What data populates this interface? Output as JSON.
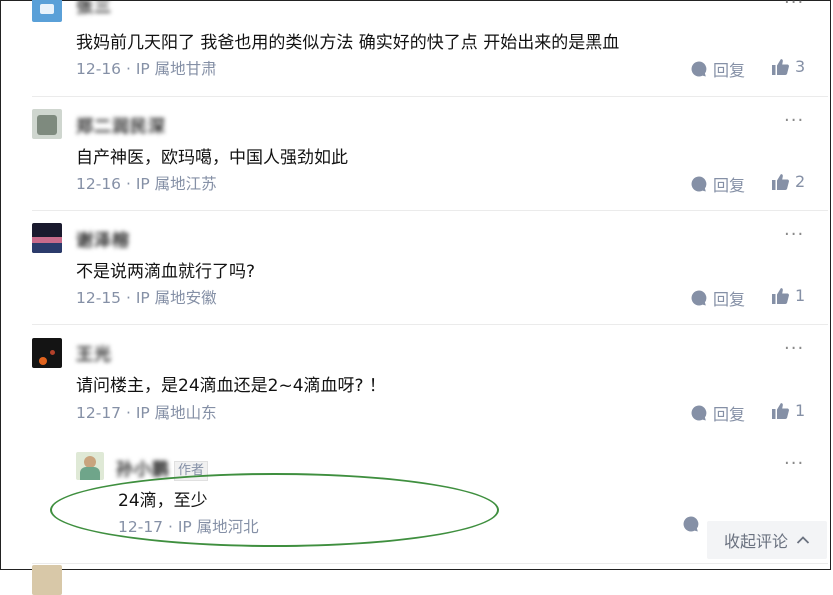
{
  "comments": [
    {
      "username": "张三",
      "text": "我妈前几天阳了 我爸也用的类似方法 确实好的快了点 开始出来的是黑血",
      "meta": "12-16 · IP 属地甘肃",
      "reply_label": "回复",
      "likes": "3"
    },
    {
      "username": "郑二润民深",
      "text": "自产神医，欧玛噶，中国人强劲如此",
      "meta": "12-16 · IP 属地江苏",
      "reply_label": "回复",
      "likes": "2"
    },
    {
      "username": "谢泽榕",
      "text": "不是说两滴血就行了吗?",
      "meta": "12-15 · IP 属地安徽",
      "reply_label": "回复",
      "likes": "1"
    },
    {
      "username": "王光",
      "text": "请问楼主，是24滴血还是2~4滴血呀? ！",
      "meta": "12-17 · IP 属地山东",
      "reply_label": "回复",
      "likes": "1"
    }
  ],
  "reply": {
    "username": "孙小鹏",
    "author_tag": "作者",
    "text": "24滴，至少",
    "meta": "12-17 · IP 属地河北"
  },
  "more_label": "···",
  "collapse_label": "收起评论",
  "colors": {
    "text": "#121212",
    "meta": "#8590a6",
    "highlight_oval": "#3f8f3f"
  },
  "icons": [
    "comment-bubble-icon",
    "thumbs-up-icon",
    "chevron-up-icon",
    "more-dots-icon"
  ]
}
